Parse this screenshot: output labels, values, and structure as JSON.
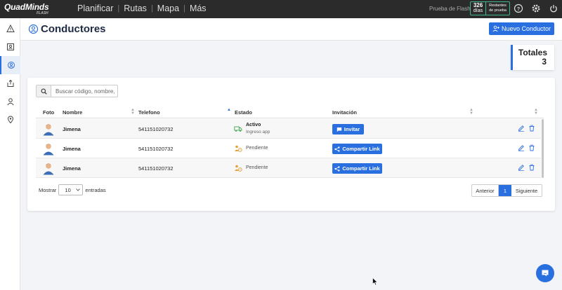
{
  "app": {
    "logo": "QuadMinds",
    "logo_sub": "FLASH",
    "nav": [
      "Planificar",
      "Rutas",
      "Mapa",
      "Más"
    ],
    "trial_label": "Prueba de Flash",
    "days_count": "326",
    "days_unit": "días",
    "remaining_line1": "Restantes",
    "remaining_line2": "de prueba"
  },
  "sidebar": {
    "items": [
      "warning-icon",
      "contacts-icon",
      "location-pin-icon",
      "export-icon",
      "user-icon",
      "map-pin-icon"
    ],
    "active_index": 2
  },
  "page": {
    "title": "Conductores",
    "new_button": "Nuevo Conductor",
    "totals_label": "Totales",
    "totals_value": "3"
  },
  "search": {
    "placeholder": "Buscar código, nombre,"
  },
  "table": {
    "columns": [
      "Foto",
      "Nombre",
      "Telefono",
      "Estado",
      "Invitación"
    ],
    "sorted_column": "Telefono",
    "rows": [
      {
        "name": "Jimena",
        "phone": "541151020732",
        "status": "Activo",
        "status_sub": "Ingreso app",
        "action": "Invitar"
      },
      {
        "name": "Jimena",
        "phone": "541151020732",
        "status": "Pendiente",
        "status_sub": "",
        "action": "Compartir Link"
      },
      {
        "name": "Jimena",
        "phone": "541151020732",
        "status": "Pendiente",
        "status_sub": "",
        "action": "Compartir Link"
      }
    ]
  },
  "footer": {
    "show_label": "Mostrar",
    "page_size": "10",
    "entries_label": "entradas",
    "prev": "Anterior",
    "current_page": "1",
    "next": "Siguiente"
  },
  "colors": {
    "accent": "#2a6fe0",
    "topbar": "#2b2b2b",
    "trial_border": "#3fb58a",
    "active_status": "#3fa44a",
    "pending_status": "#e0a13a"
  }
}
